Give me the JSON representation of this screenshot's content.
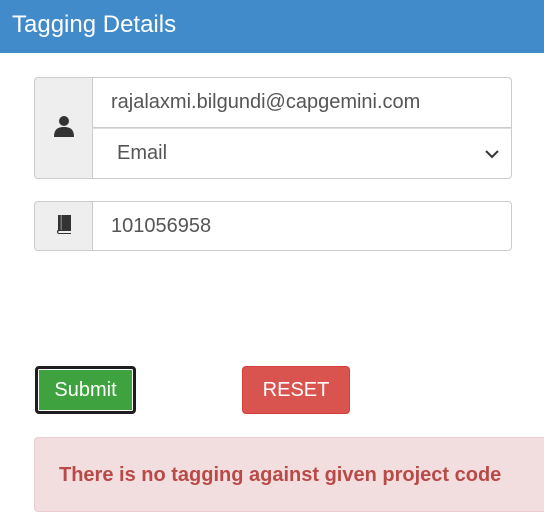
{
  "header": {
    "title": "Tagging Details"
  },
  "form": {
    "email_value": "rajalaxmi.bilgundi@capgemini.com",
    "id_type_selected": "Email",
    "project_code_value": "101056958"
  },
  "icons": {
    "user": "user-icon",
    "book": "book-icon",
    "dropdown": "chevron-down-icon"
  },
  "buttons": {
    "submit_label": "Submit",
    "reset_label": "RESET"
  },
  "alert": {
    "message": "There is no tagging against given project code"
  },
  "colors": {
    "header_bg": "#428bca",
    "submit_bg": "#3ea23f",
    "reset_bg": "#d9534f",
    "alert_bg": "#f2dede",
    "alert_text": "#b94a48"
  }
}
